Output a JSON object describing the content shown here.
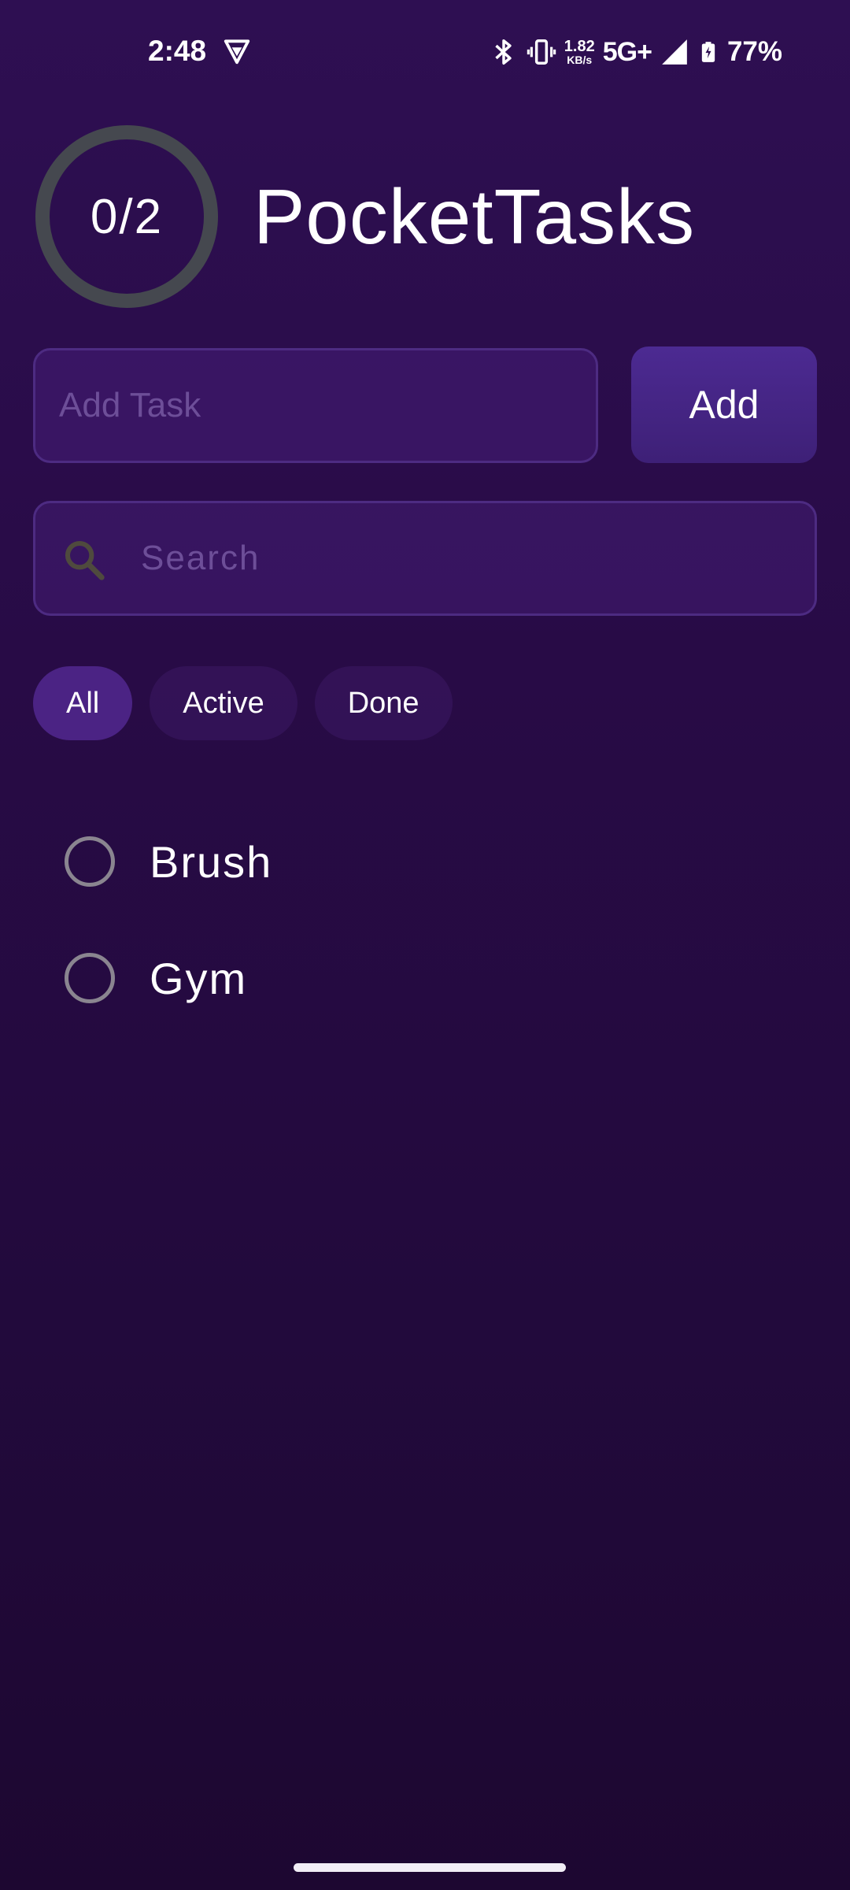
{
  "status_bar": {
    "time": "2:48",
    "net_speed_value": "1.82",
    "net_speed_unit": "KB/s",
    "network": "5G+",
    "battery": "77%",
    "icons": [
      "vpn-icon",
      "bluetooth-icon",
      "vibrate-icon",
      "signal-icon",
      "battery-charging-icon"
    ]
  },
  "header": {
    "progress_text": "0/2",
    "completed": 0,
    "total": 2,
    "title": "PocketTasks"
  },
  "add_task": {
    "placeholder": "Add Task",
    "value": "",
    "button_label": "Add"
  },
  "search": {
    "placeholder": "Search",
    "value": ""
  },
  "filters": [
    {
      "label": "All",
      "selected": true
    },
    {
      "label": "Active",
      "selected": false
    },
    {
      "label": "Done",
      "selected": false
    }
  ],
  "tasks": [
    {
      "label": "Brush",
      "done": false
    },
    {
      "label": "Gym",
      "done": false
    }
  ],
  "colors": {
    "background_top": "#2e0f52",
    "background_bottom": "#1d0731",
    "accent": "#4b2384",
    "ring": "#45484f",
    "checkbox": "#8a8590",
    "placeholder": "#6d4e98"
  }
}
